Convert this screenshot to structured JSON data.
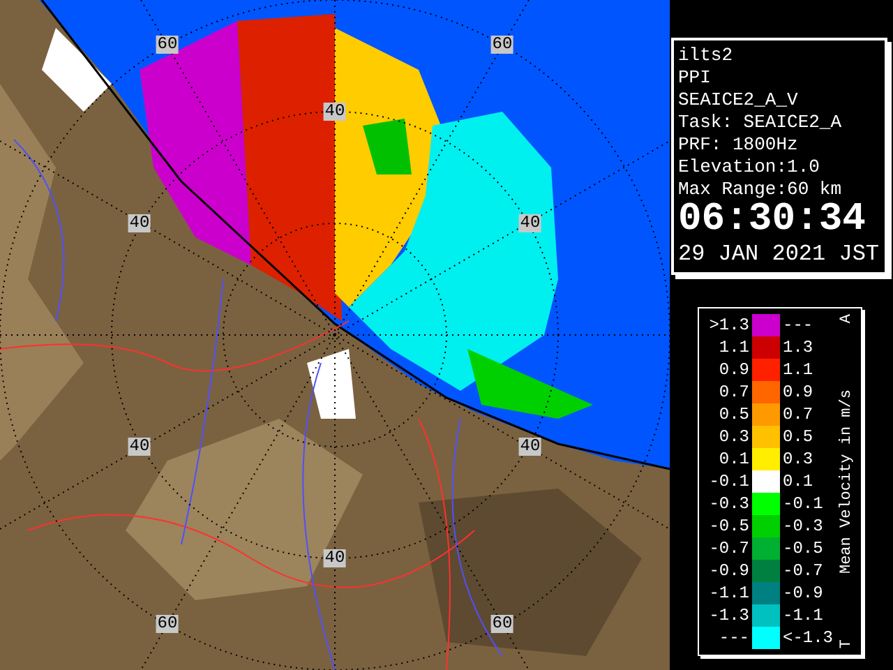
{
  "radar_map": {
    "range_labels": [
      "60",
      "60",
      "40",
      "40",
      "40",
      "40",
      "40",
      "40",
      "60",
      "60"
    ]
  },
  "info_panel": {
    "lines": [
      "ilts2",
      "PPI",
      "SEAICE2_A_V",
      "Task: SEAICE2_A",
      "PRF: 1800Hz",
      "Elevation:1.0",
      "Max Range:60 km"
    ],
    "time": "06:30:34",
    "date": "29 JAN 2021 JST"
  },
  "legend": {
    "top_mark": "A",
    "title": "Mean Velocity in m/s",
    "bottom_mark": "T",
    "rows": [
      {
        "low": ">1.3",
        "high": "---",
        "color": "#cc00cc"
      },
      {
        "low": "1.1",
        "high": "1.3",
        "color": "#cc0000"
      },
      {
        "low": "0.9",
        "high": "1.1",
        "color": "#ff2000"
      },
      {
        "low": "0.7",
        "high": "0.9",
        "color": "#ff6600"
      },
      {
        "low": "0.5",
        "high": "0.7",
        "color": "#ff9900"
      },
      {
        "low": "0.3",
        "high": "0.5",
        "color": "#ffc000"
      },
      {
        "low": "0.1",
        "high": "0.3",
        "color": "#ffee00"
      },
      {
        "low": "-0.1",
        "high": "0.1",
        "color": "#ffffff"
      },
      {
        "low": "-0.3",
        "high": "-0.1",
        "color": "#00ff00"
      },
      {
        "low": "-0.5",
        "high": "-0.3",
        "color": "#00d000"
      },
      {
        "low": "-0.7",
        "high": "-0.5",
        "color": "#00b030"
      },
      {
        "low": "-0.9",
        "high": "-0.7",
        "color": "#008040"
      },
      {
        "low": "-1.1",
        "high": "-0.9",
        "color": "#008080"
      },
      {
        "low": "-1.3",
        "high": "-1.1",
        "color": "#00c0c0"
      },
      {
        "low": "---",
        "high": "<-1.3",
        "color": "#00ffff"
      }
    ]
  }
}
